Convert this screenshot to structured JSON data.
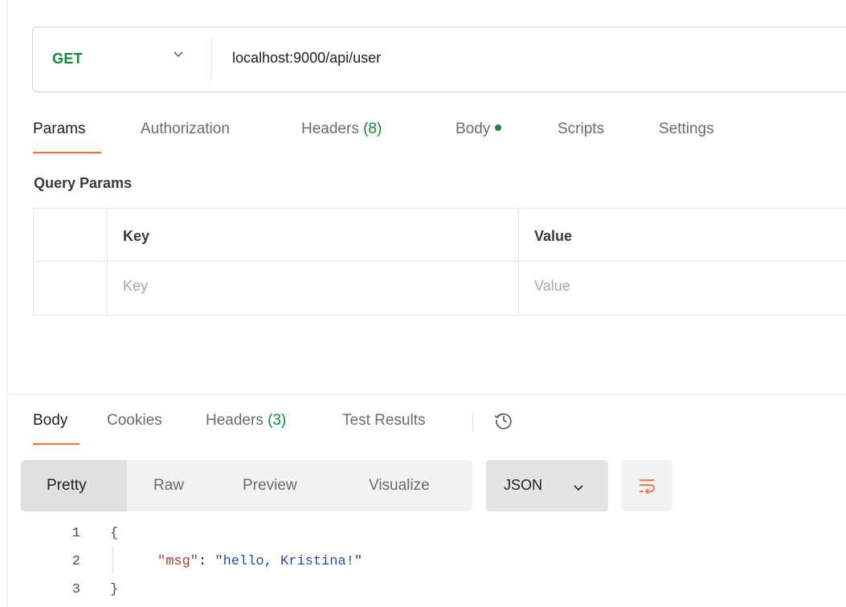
{
  "request": {
    "method": "GET",
    "url": "localhost:9000/api/user"
  },
  "request_tabs": [
    {
      "label": "Params",
      "active": true
    },
    {
      "label": "Authorization"
    },
    {
      "label": "Headers",
      "count": "(8)"
    },
    {
      "label": "Body",
      "has_dot": true
    },
    {
      "label": "Scripts"
    },
    {
      "label": "Settings"
    }
  ],
  "query_params": {
    "title": "Query Params",
    "headers": {
      "key": "Key",
      "value": "Value"
    },
    "placeholders": {
      "key": "Key",
      "value": "Value"
    }
  },
  "response_tabs": [
    {
      "label": "Body",
      "active": true
    },
    {
      "label": "Cookies"
    },
    {
      "label": "Headers",
      "count": "(3)"
    },
    {
      "label": "Test Results"
    }
  ],
  "view_modes": [
    {
      "label": "Pretty",
      "active": true
    },
    {
      "label": "Raw"
    },
    {
      "label": "Preview"
    },
    {
      "label": "Visualize"
    }
  ],
  "format": {
    "selected": "JSON"
  },
  "response_body": {
    "line_numbers": [
      "1",
      "2",
      "3"
    ],
    "open_brace": "{",
    "key": "\"msg\"",
    "colon": ": ",
    "value": "\"hello, Kristina!\"",
    "close_brace": "}"
  },
  "colors": {
    "accent": "#ff6c37",
    "method_get": "#0f8a3c",
    "count_green": "#0f8a3c",
    "json_key": "#b03b2e",
    "json_string": "#1e4fa3"
  },
  "icons": [
    "chevron-down-icon",
    "history-icon",
    "wrap-lines-icon"
  ]
}
